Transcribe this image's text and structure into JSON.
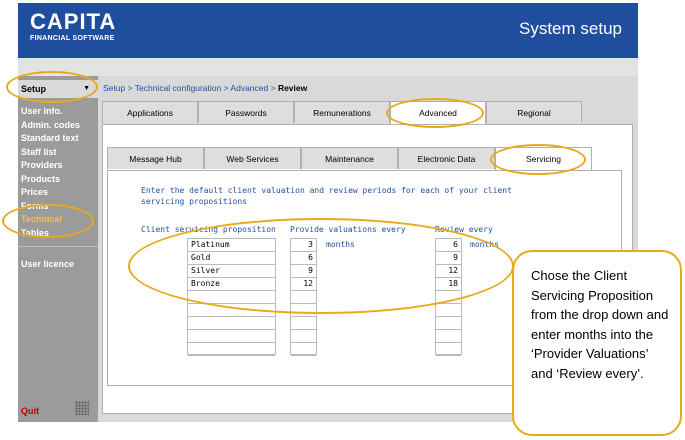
{
  "header": {
    "logo": "CAPITA",
    "logo_sub": "FINANCIAL SOFTWARE",
    "title": "System setup",
    "bg_color": "#1f4e9e"
  },
  "sidebar": {
    "setup_label": "Setup",
    "items": [
      {
        "label": "User info."
      },
      {
        "label": "Admin. codes"
      },
      {
        "label": "Standard text"
      },
      {
        "label": "Staff list"
      },
      {
        "label": "Providers"
      },
      {
        "label": "Products"
      },
      {
        "label": "Prices"
      },
      {
        "label": "Forms"
      },
      {
        "label": "Technical",
        "selected": true,
        "color": "#f2c14e"
      },
      {
        "label": "Tables"
      }
    ],
    "licence_label": "User licence",
    "quit_label": "Quit"
  },
  "breadcrumb": {
    "path": "Setup > Technical configuration > Advanced > ",
    "current": "Review"
  },
  "tabs_top": [
    "Applications",
    "Passwords",
    "Remunerations",
    "Advanced",
    "Regional"
  ],
  "tabs_top_active": "Advanced",
  "tabs_sub": [
    "Message Hub",
    "Web Services",
    "Maintenance",
    "Electronic Data",
    "Servicing"
  ],
  "tabs_sub_active": "Servicing",
  "servicing": {
    "instructions": "Enter the default client valuation and review periods for each of your client servicing propositions",
    "col_proposition": "Client servicing proposition",
    "col_valuations": "Provide valuations every",
    "col_review": "Review every",
    "months_label": "months",
    "rows": [
      {
        "proposition": "Platinum",
        "valuations": "3",
        "review": "6"
      },
      {
        "proposition": "Gold",
        "valuations": "6",
        "review": "9"
      },
      {
        "proposition": "Silver",
        "valuations": "9",
        "review": "12"
      },
      {
        "proposition": "Bronze",
        "valuations": "12",
        "review": "18"
      },
      {
        "proposition": "",
        "valuations": "",
        "review": ""
      },
      {
        "proposition": "",
        "valuations": "",
        "review": ""
      },
      {
        "proposition": "",
        "valuations": "",
        "review": ""
      },
      {
        "proposition": "",
        "valuations": "",
        "review": ""
      },
      {
        "proposition": "",
        "valuations": "",
        "review": ""
      }
    ]
  },
  "callout": {
    "text": "Chose the Client Servicing Proposition from the drop down and enter months into the ‘Provider Valuations’ and ‘Review every’.",
    "border_color": "#e8a91a"
  }
}
